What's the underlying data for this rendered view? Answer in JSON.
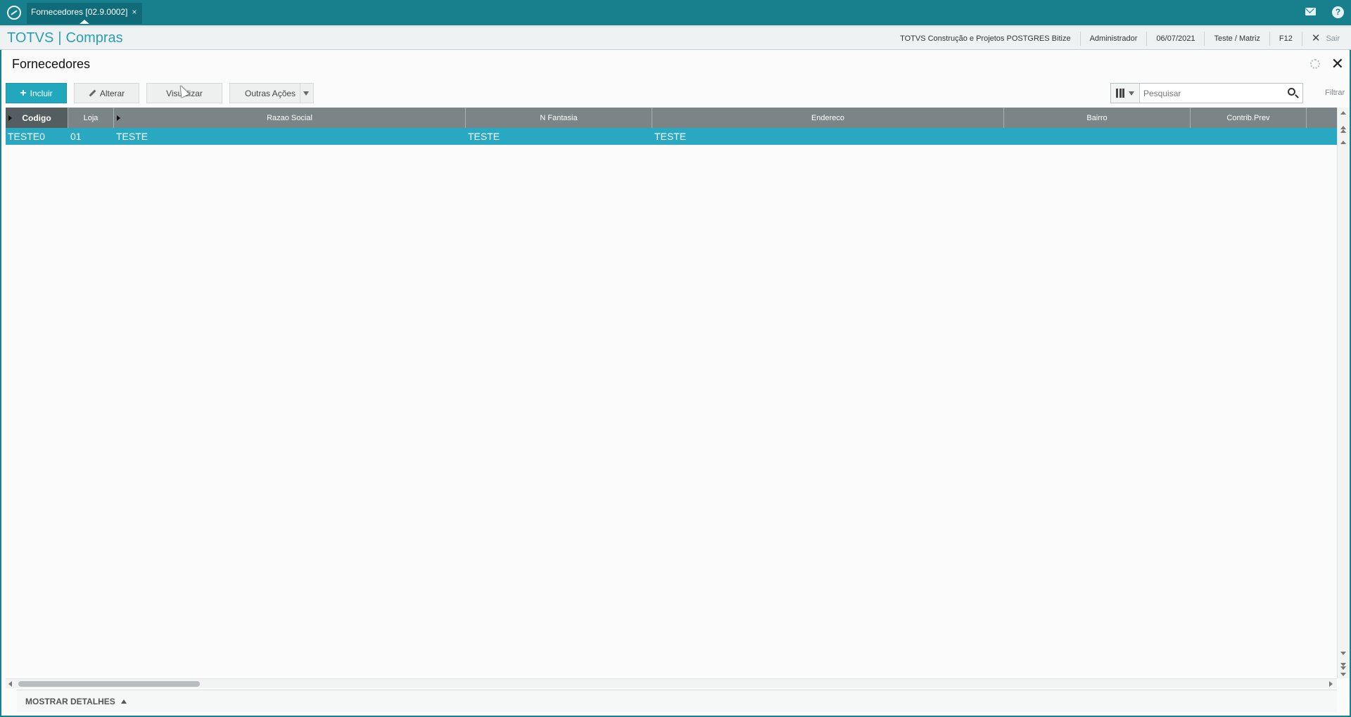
{
  "app_tab": {
    "label": "Fornecedores [02.9.0002]",
    "close": "×"
  },
  "header": {
    "brand": "TOTVS",
    "module": "Compras",
    "company": "TOTVS Construção e Projetos POSTGRES Bitize",
    "user": "Administrador",
    "date": "06/07/2021",
    "branch": "Teste / Matriz",
    "shortcut": "F12",
    "exit_label": "Sair"
  },
  "page": {
    "title": "Fornecedores"
  },
  "toolbar": {
    "include": "Incluir",
    "edit": "Alterar",
    "view": "Visualizar",
    "more": "Outras Ações",
    "search_placeholder": "Pesquisar",
    "filter": "Filtrar"
  },
  "grid": {
    "columns": [
      "Codigo",
      "Loja",
      "Razao Social",
      "N Fantasia",
      "Endereco",
      "Bairro",
      "Contrib.Prev"
    ],
    "rows": [
      [
        "TESTE0",
        "01",
        "TESTE",
        "TESTE",
        "TESTE",
        "",
        ""
      ]
    ]
  },
  "footer": {
    "details": "MOSTRAR DETALHES"
  },
  "colors": {
    "teal": "#187f8d",
    "accent": "#22a8bd",
    "selected_row": "#29a9c1",
    "header_gray": "#7b8587"
  }
}
